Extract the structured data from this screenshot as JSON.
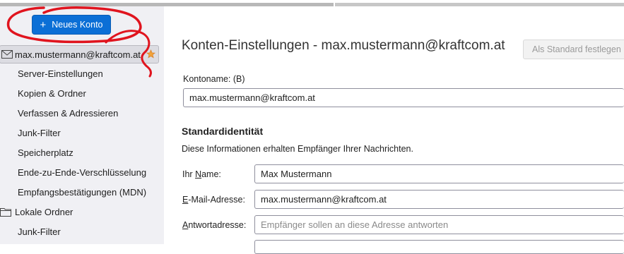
{
  "sidebar": {
    "new_account_label": "Neues Konto",
    "account": "max.mustermann@kraftcom.at",
    "items": [
      "Server-Einstellungen",
      "Kopien & Ordner",
      "Verfassen & Adressieren",
      "Junk-Filter",
      "Speicherplatz",
      "Ende-zu-Ende-Verschlüsselung",
      "Empfangsbestätigungen (MDN)"
    ],
    "local_folders": "Lokale Ordner",
    "local_items": [
      "Junk-Filter"
    ]
  },
  "main": {
    "title": "Konten-Einstellungen - max.mustermann@kraftcom.at",
    "set_default_label": "Als Standard festlegen",
    "account_name_label": "Kontoname: (B)",
    "account_name_value": "max.mustermann@kraftcom.at",
    "identity_title": "Standardidentität",
    "identity_desc": "Diese Informationen erhalten Empfänger Ihrer Nachrichten.",
    "name_label_u": "N",
    "name_label_pre": "Ihr ",
    "name_label_post": "ame:",
    "name_value": "Max Mustermann",
    "email_label_u": "E",
    "email_label_post": "-Mail-Adresse:",
    "email_value": "max.mustermann@kraftcom.at",
    "reply_label_u": "A",
    "reply_label_post": "ntwortadresse:",
    "reply_placeholder": "Empfänger sollen an diese Adresse antworten"
  },
  "colors": {
    "accent": "#0b6fd6",
    "annotation": "#e0141e",
    "sidebar_bg": "#f0f0f4"
  }
}
